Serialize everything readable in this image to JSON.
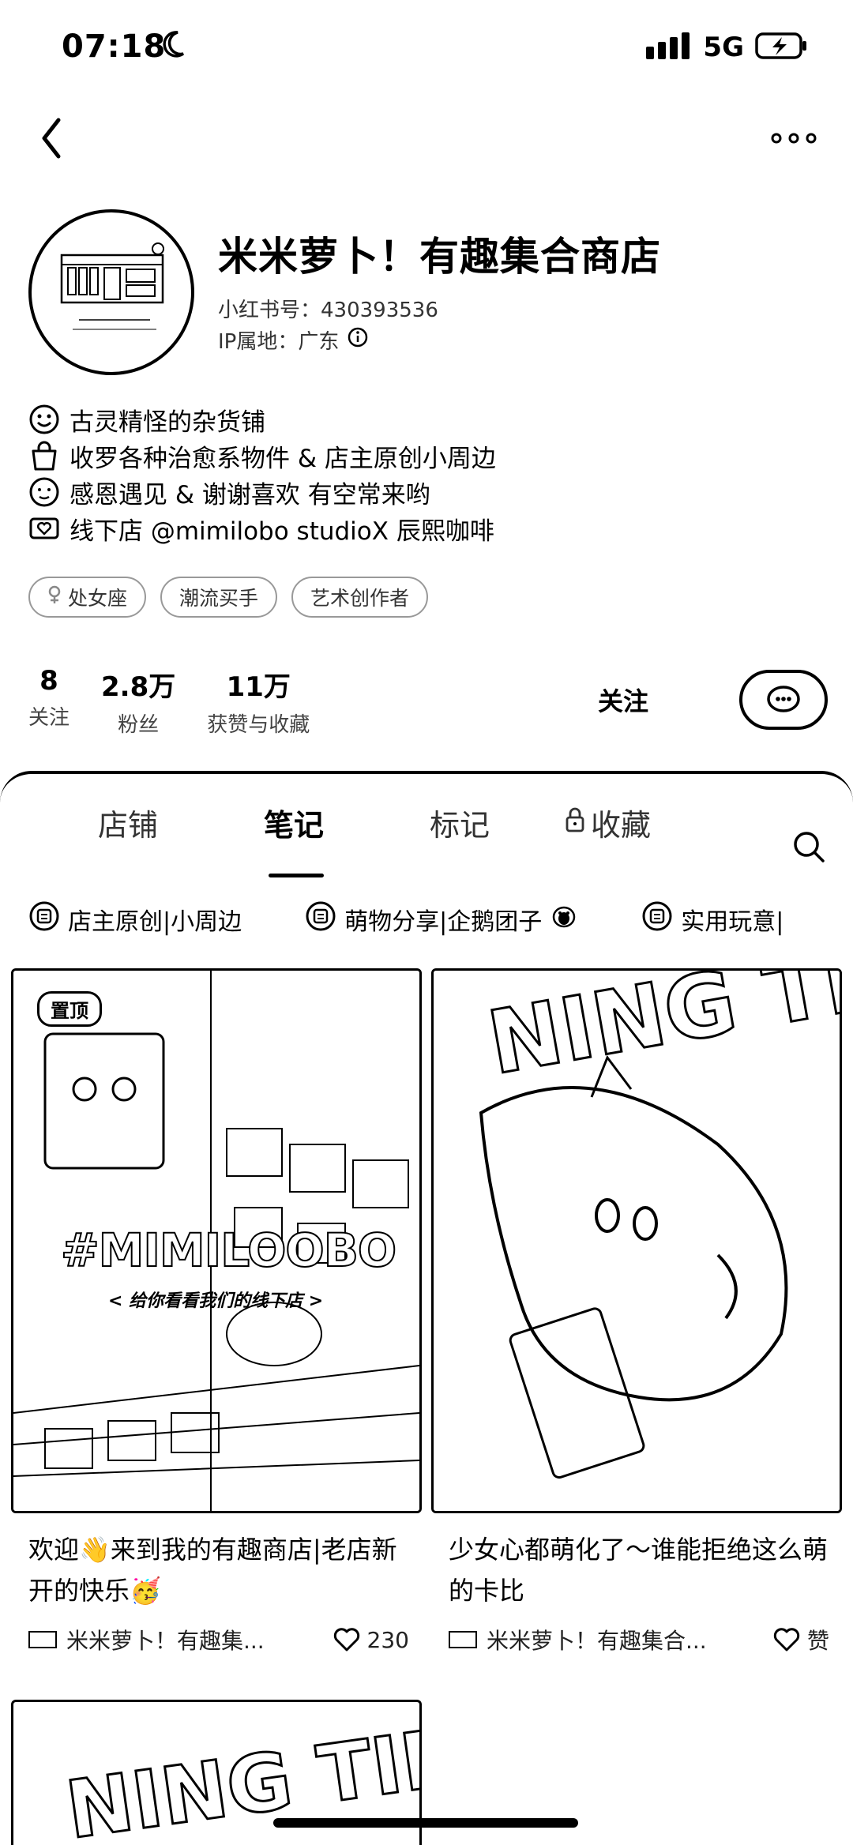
{
  "status_bar": {
    "time": "07:18",
    "network": "5G"
  },
  "profile": {
    "name": "米米萝卜！有趣集合商店",
    "red_id": "小红书号：430393536",
    "ip_location": "IP属地：广东"
  },
  "bio": [
    {
      "text": "古灵精怪的杂货铺",
      "icon": "smiley-face-icon"
    },
    {
      "text": "收罗各种治愈系物件 & 店主原创小周边",
      "icon": "shopping-bag-icon"
    },
    {
      "text": "感恩遇见 & 谢谢喜欢 有空常来哟",
      "icon": "happy-face-icon"
    },
    {
      "text": "线下店 @mimilobo studioX 辰熙咖啡",
      "icon": "heart-letter-icon"
    }
  ],
  "tags": [
    "处女座",
    "潮流买手",
    "艺术创作者"
  ],
  "stats": [
    {
      "value": "8",
      "label": "关注"
    },
    {
      "value": "2.8万",
      "label": "粉丝"
    },
    {
      "value": "11万",
      "label": "获赞与收藏"
    }
  ],
  "actions": {
    "follow_label": "关注"
  },
  "tabs": [
    "店铺",
    "笔记",
    "标记",
    "收藏"
  ],
  "active_tab": "笔记",
  "chips": [
    "店主原创|小周边",
    "萌物分享|企鹅团子",
    "实用玩意|"
  ],
  "notes": [
    {
      "pin_label": "置顶",
      "cover_text": "#MIMILOOBO",
      "cover_subtext": "< 给你看看我们的线下店 >",
      "title": "欢迎👋来到我的有趣商店|老店新开的快乐🥳",
      "author": "米米萝卜！有趣集...",
      "likes": "230"
    },
    {
      "cover_text": "NING TI",
      "title": "少女心都萌化了～谁能拒绝这么萌的卡比",
      "author": "米米萝卜！有趣集合...",
      "likes": "赞"
    }
  ],
  "next_row_cover_text": "NING TIN"
}
